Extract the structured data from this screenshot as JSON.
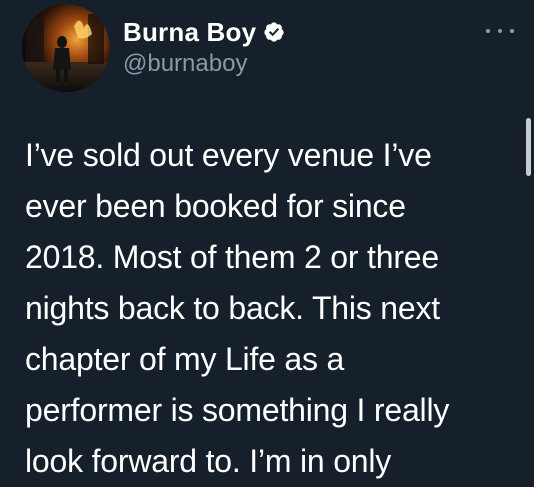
{
  "tweet": {
    "author": {
      "display_name": "Burna Boy",
      "handle": "@burnaboy",
      "verified": true,
      "avatar_icon": "avatar-image"
    },
    "more_icon": "more-options-icon",
    "text_lines": [
      "I’ve sold out every venue I’ve",
      "ever been booked for since",
      "2018. Most of them 2 or three",
      "nights back to back. This next",
      "chapter of my Life as a",
      "performer is something I really",
      "look forward to. I’m in only"
    ]
  },
  "colors": {
    "background": "#15202b",
    "primary_text": "#ffffff",
    "secondary_text": "#8b98a5",
    "verified_badge": "#ffffff"
  }
}
